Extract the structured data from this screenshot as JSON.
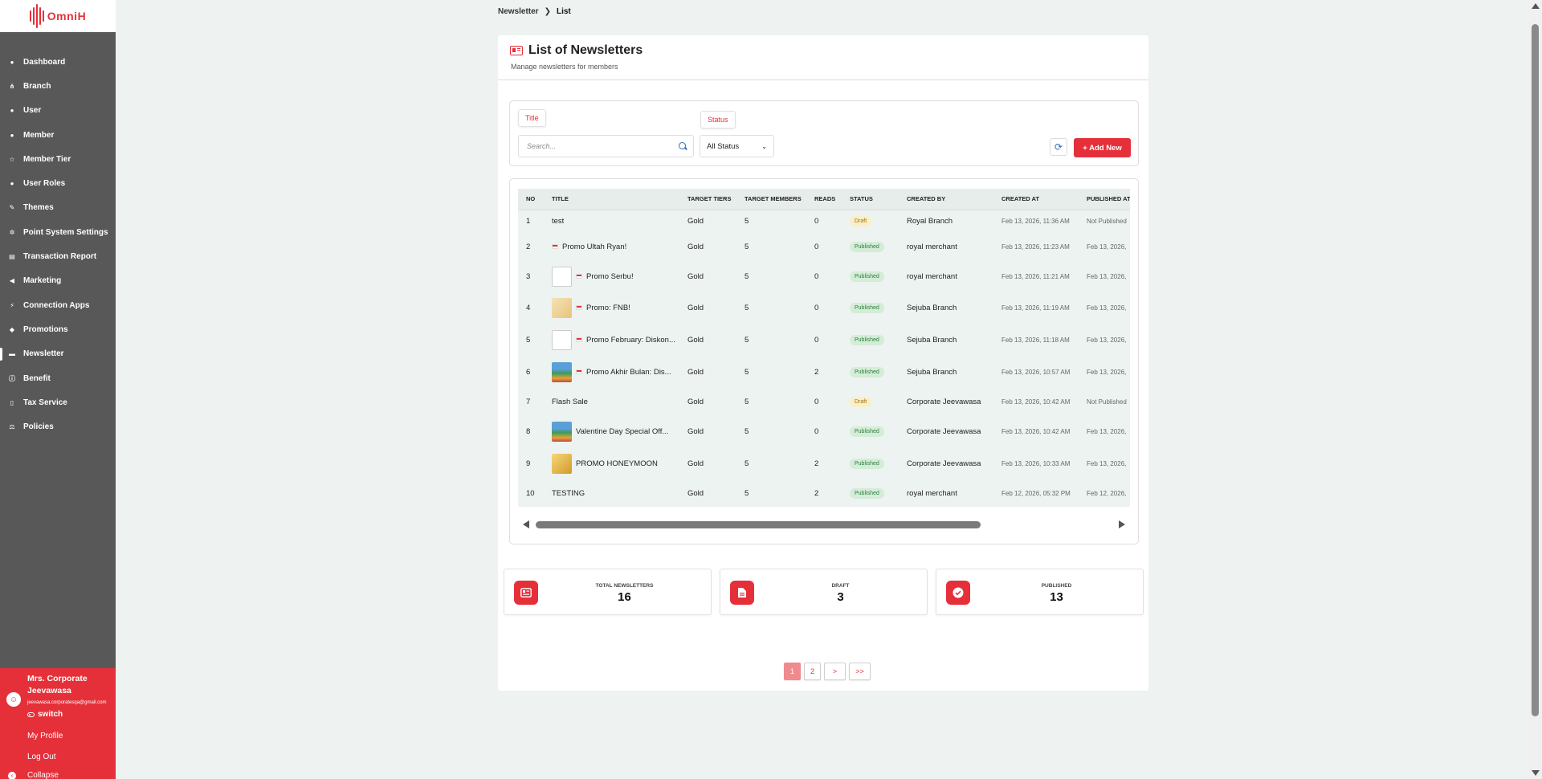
{
  "app": {
    "logo_text": "OmniH"
  },
  "sidebar": {
    "items": [
      {
        "label": "Dashboard",
        "icon": "dashboard-icon",
        "glyph": "●"
      },
      {
        "label": "Branch",
        "icon": "branch-icon",
        "glyph": "⋔"
      },
      {
        "label": "User",
        "icon": "user-icon",
        "glyph": "●"
      },
      {
        "label": "Member",
        "icon": "members-icon",
        "glyph": "●"
      },
      {
        "label": "Member Tier",
        "icon": "star-icon",
        "glyph": "☆"
      },
      {
        "label": "User Roles",
        "icon": "user-roles-icon",
        "glyph": "●"
      },
      {
        "label": "Themes",
        "icon": "brush-icon",
        "glyph": "✎"
      },
      {
        "label": "Point System Settings",
        "icon": "gear-icon",
        "glyph": "✲"
      },
      {
        "label": "Transaction Report",
        "icon": "report-icon",
        "glyph": "▤"
      },
      {
        "label": "Marketing",
        "icon": "megaphone-icon",
        "glyph": "◀"
      },
      {
        "label": "Connection Apps",
        "icon": "plug-icon",
        "glyph": "⚡"
      },
      {
        "label": "Promotions",
        "icon": "tag-icon",
        "glyph": "◆"
      },
      {
        "label": "Newsletter",
        "icon": "newsletter-icon",
        "glyph": "▬",
        "active": true
      },
      {
        "label": "Benefit",
        "icon": "info-icon",
        "glyph": "ⓘ"
      },
      {
        "label": "Tax Service",
        "icon": "document-icon",
        "glyph": "▯"
      },
      {
        "label": "Policies",
        "icon": "policies-icon",
        "glyph": "⚖"
      }
    ]
  },
  "user_panel": {
    "name": "Mrs. Corporate Jeevawasa",
    "email": "jeevawasa.corporatesqa@gmail.com",
    "switch_label": "switch",
    "my_profile": "My Profile",
    "logout": "Log Out",
    "collapse": "Collapse"
  },
  "breadcrumb": {
    "parent": "Newsletter",
    "current": "List"
  },
  "header": {
    "title": "List of Newsletters",
    "subtitle": "Manage newsletters for members"
  },
  "filters": {
    "title_tag": "Title",
    "status_tag": "Status",
    "search_placeholder": "Search...",
    "status_value": "All Status",
    "add_new_label": "+ Add New"
  },
  "table": {
    "columns": [
      "NO",
      "TITLE",
      "TARGET TIERS",
      "TARGET MEMBERS",
      "READS",
      "STATUS",
      "CREATED BY",
      "CREATED AT",
      "PUBLISHED AT"
    ],
    "rows": [
      {
        "no": "1",
        "title": "test",
        "thumb": "",
        "flag": false,
        "tiers": "Gold",
        "members": "5",
        "reads": "0",
        "status": "Draft",
        "created_by": "Royal Branch",
        "created_at": "Feb 13, 2026, 11:36 AM",
        "published_at": "Not Published"
      },
      {
        "no": "2",
        "title": "Promo Ultah Ryan!",
        "thumb": "",
        "flag": true,
        "tiers": "Gold",
        "members": "5",
        "reads": "0",
        "status": "Published",
        "created_by": "royal merchant",
        "created_at": "Feb 13, 2026, 11:23 AM",
        "published_at": "Feb 13, 2026,"
      },
      {
        "no": "3",
        "title": "Promo Serbu!",
        "thumb": "white",
        "flag": true,
        "tiers": "Gold",
        "members": "5",
        "reads": "0",
        "status": "Published",
        "created_by": "royal merchant",
        "created_at": "Feb 13, 2026, 11:21 AM",
        "published_at": "Feb 13, 2026,"
      },
      {
        "no": "4",
        "title": "Promo: FNB!",
        "thumb": "beige",
        "flag": true,
        "tiers": "Gold",
        "members": "5",
        "reads": "0",
        "status": "Published",
        "created_by": "Sejuba Branch",
        "created_at": "Feb 13, 2026, 11:19 AM",
        "published_at": "Feb 13, 2026,"
      },
      {
        "no": "5",
        "title": "Promo February: Diskon...",
        "thumb": "white",
        "flag": true,
        "tiers": "Gold",
        "members": "5",
        "reads": "0",
        "status": "Published",
        "created_by": "Sejuba Branch",
        "created_at": "Feb 13, 2026, 11:18 AM",
        "published_at": "Feb 13, 2026,"
      },
      {
        "no": "6",
        "title": "Promo Akhir Bulan: Dis...",
        "thumb": "landscape",
        "flag": true,
        "tiers": "Gold",
        "members": "5",
        "reads": "2",
        "status": "Published",
        "created_by": "Sejuba Branch",
        "created_at": "Feb 13, 2026, 10:57 AM",
        "published_at": "Feb 13, 2026,"
      },
      {
        "no": "7",
        "title": "Flash Sale",
        "thumb": "",
        "flag": false,
        "tiers": "Gold",
        "members": "5",
        "reads": "0",
        "status": "Draft",
        "created_by": "Corporate Jeevawasa",
        "created_at": "Feb 13, 2026, 10:42 AM",
        "published_at": "Not Published"
      },
      {
        "no": "8",
        "title": "Valentine Day Special Off...",
        "thumb": "landscape",
        "flag": false,
        "tiers": "Gold",
        "members": "5",
        "reads": "0",
        "status": "Published",
        "created_by": "Corporate Jeevawasa",
        "created_at": "Feb 13, 2026, 10:42 AM",
        "published_at": "Feb 13, 2026,"
      },
      {
        "no": "9",
        "title": "PROMO HONEYMOON",
        "thumb": "gold",
        "flag": false,
        "tiers": "Gold",
        "members": "5",
        "reads": "2",
        "status": "Published",
        "created_by": "Corporate Jeevawasa",
        "created_at": "Feb 13, 2026, 10:33 AM",
        "published_at": "Feb 13, 2026,"
      },
      {
        "no": "10",
        "title": "TESTING",
        "thumb": "",
        "flag": false,
        "tiers": "Gold",
        "members": "5",
        "reads": "2",
        "status": "Published",
        "created_by": "royal merchant",
        "created_at": "Feb 12, 2026, 05:32 PM",
        "published_at": "Feb 12, 2026,"
      }
    ]
  },
  "stats": {
    "total_label": "TOTAL NEWSLETTERS",
    "total_value": "16",
    "draft_label": "DRAFT",
    "draft_value": "3",
    "published_label": "PUBLISHED",
    "published_value": "13"
  },
  "pagination": {
    "pages": [
      "1",
      "2"
    ],
    "active": "1",
    "next": ">",
    "last": ">>"
  },
  "colors": {
    "accent": "#e5303a",
    "sidebar_bg": "#585858",
    "page_bg": "#eef2f1"
  }
}
